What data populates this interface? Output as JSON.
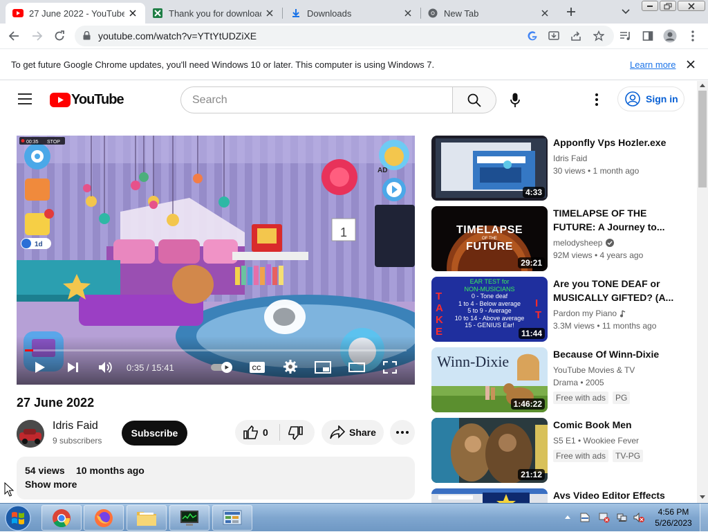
{
  "browser": {
    "tabs": [
      {
        "title": "27 June 2022 - YouTube",
        "icon": "youtube-icon",
        "active": true
      },
      {
        "title": "Thank you for downloading",
        "icon": "sheet-icon",
        "active": false
      },
      {
        "title": "Downloads",
        "icon": "download-icon",
        "active": false
      },
      {
        "title": "New Tab",
        "icon": "chrome-icon",
        "active": false
      }
    ],
    "url": "youtube.com/watch?v=YTtYtUDZiXE",
    "infobar": {
      "message": "To get future Google Chrome updates, you'll need Windows 10 or later. This computer is using Windows 7.",
      "link": "Learn more"
    }
  },
  "youtube": {
    "search_placeholder": "Search",
    "signin_label": "Sign in",
    "logo_text": "YouTube",
    "player": {
      "time": "0:35 / 15:41",
      "rec_time": "00:35",
      "rec_stop": "STOP",
      "game_label_ad": "AD",
      "game_label_1d": "1d",
      "game_calendar": "1"
    },
    "video": {
      "title": "27 June 2022",
      "channel": "Idris Faid",
      "subscribers": "9 subscribers",
      "subscribe_label": "Subscribe",
      "likes": "0",
      "share_label": "Share",
      "views": "54 views",
      "age": "10 months ago",
      "show_more": "Show more"
    },
    "recommendations": [
      {
        "title": "Apponfly Vps Hozler.exe",
        "channel": "Idris Faid",
        "meta": "30 views  • 1 month ago",
        "duration": "4:33"
      },
      {
        "title": "TIMELAPSE OF THE FUTURE: A Journey to...",
        "channel": "melodysheep",
        "meta": "92M views  • 4 years ago",
        "duration": "29:21",
        "thumb_text_1": "TIMELAPSE",
        "thumb_text_2": "OF THE",
        "thumb_text_3": "FUTURE"
      },
      {
        "title": "Are you TONE DEAF or MUSICALLY GIFTED? (A...",
        "channel": "Pardon my Piano",
        "meta": "3.3M views  • 11 months ago",
        "duration": "11:44",
        "thumb_lines": [
          "EAR TEST for",
          "NON-MUSICIANS",
          "0 - Tone deaf",
          "1 to 4 - Below average",
          "5 to 9 - Average",
          "10 to 14 - Above average",
          "15 - GENIUS Ear!"
        ],
        "thumb_side_left": "TAKE",
        "thumb_side_right": "IT"
      },
      {
        "title": "Because Of Winn-Dixie",
        "channel": "YouTube Movies & TV",
        "meta": "Drama • 2005",
        "duration": "1:46:22",
        "badge1": "Free with ads",
        "badge2": "PG",
        "thumb_text": "Winn-Dixie"
      },
      {
        "title": "Comic Book Men",
        "channel": "S5 E1 • Wookiee Fever",
        "duration": "21:12",
        "badge1": "Free with ads",
        "badge2": "TV-PG"
      },
      {
        "title": "Avs Video Editor Effects"
      }
    ]
  },
  "taskbar": {
    "time": "4:56 PM",
    "date": "5/26/2023"
  }
}
